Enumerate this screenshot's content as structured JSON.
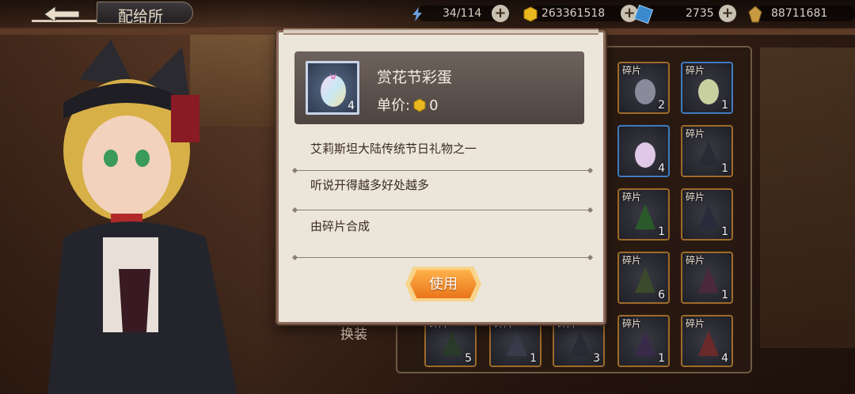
{
  "header": {
    "title": "配给所",
    "back_icon": "back-arrow-icon"
  },
  "resources": {
    "stamina": {
      "icon": "lightning-icon",
      "value": "34/114"
    },
    "gold": {
      "icon": "gold-coin-icon",
      "value": "263361518"
    },
    "crystal": {
      "icon": "blue-crystal-icon",
      "value": "2735"
    },
    "points": {
      "icon": "gold-leaf-icon",
      "value": "88711681"
    }
  },
  "popup": {
    "item_name": "赏花节彩蛋",
    "item_count": "4",
    "price_label": "单价:",
    "price_value": "0",
    "descriptions": [
      "艾莉斯坦大陆传统节日礼物之一",
      "听说开得越多好处越多",
      "由碎片合成"
    ],
    "use_button": "使用"
  },
  "inventory": {
    "swap_label": "换装",
    "slots": [
      {
        "frag": "碎片",
        "count": "2",
        "border": "gold"
      },
      {
        "frag": "碎片",
        "count": "1",
        "border": "blue"
      },
      {
        "frag": "",
        "count": "4",
        "border": "blue"
      },
      {
        "frag": "碎片",
        "count": "1",
        "border": "gold"
      },
      {
        "frag": "碎片",
        "count": "1",
        "border": "gold"
      },
      {
        "frag": "碎片",
        "count": "1",
        "border": "gold"
      },
      {
        "frag": "碎片",
        "count": "6",
        "border": "gold"
      },
      {
        "frag": "碎片",
        "count": "1",
        "border": "gold"
      },
      {
        "frag": "碎片",
        "count": "5",
        "border": "gold"
      },
      {
        "frag": "碎片",
        "count": "1",
        "border": "gold"
      },
      {
        "frag": "碎片",
        "count": "3",
        "border": "gold"
      },
      {
        "frag": "碎片",
        "count": "1",
        "border": "gold"
      },
      {
        "frag": "碎片",
        "count": "4",
        "border": "gold"
      }
    ]
  },
  "colors": {
    "accent_orange": "#e9741a",
    "slot_gold": "#a06a2a",
    "slot_blue": "#3f7bc0"
  }
}
